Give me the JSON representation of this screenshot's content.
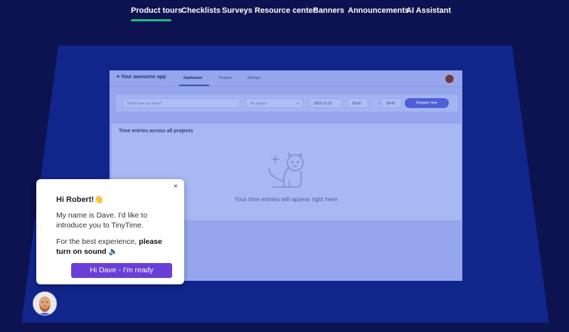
{
  "nav": {
    "items": [
      "Product tours",
      "Checklists",
      "Surveys",
      "Resource center",
      "Banners",
      "Announcements",
      "AI Assistant"
    ],
    "active_color": "#1fbf7a"
  },
  "app": {
    "logo": "Your awesome app",
    "tabs": [
      "Dashboard",
      "Projects",
      "Settings"
    ],
    "toolbar": {
      "placeholder": "What have you done?",
      "project": "No project",
      "date": "2022-12-22",
      "start": "08:42",
      "arrow": "→",
      "end": "09:42",
      "register": "Register time"
    },
    "entries": {
      "title": "Time entries across all projects",
      "empty": "Your time entries will appear right here"
    }
  },
  "popup": {
    "greeting": "Hi Robert!👋",
    "body1": "My name is Dave. I'd like to introduce you to TinyTime.",
    "body2_prefix": "For the best experience, ",
    "body2_bold": "please turn on sound",
    "body2_suffix": " 🔉",
    "cta": "Hi Dave - I'm ready",
    "close": "×",
    "cta_color": "#6a3fd8"
  }
}
